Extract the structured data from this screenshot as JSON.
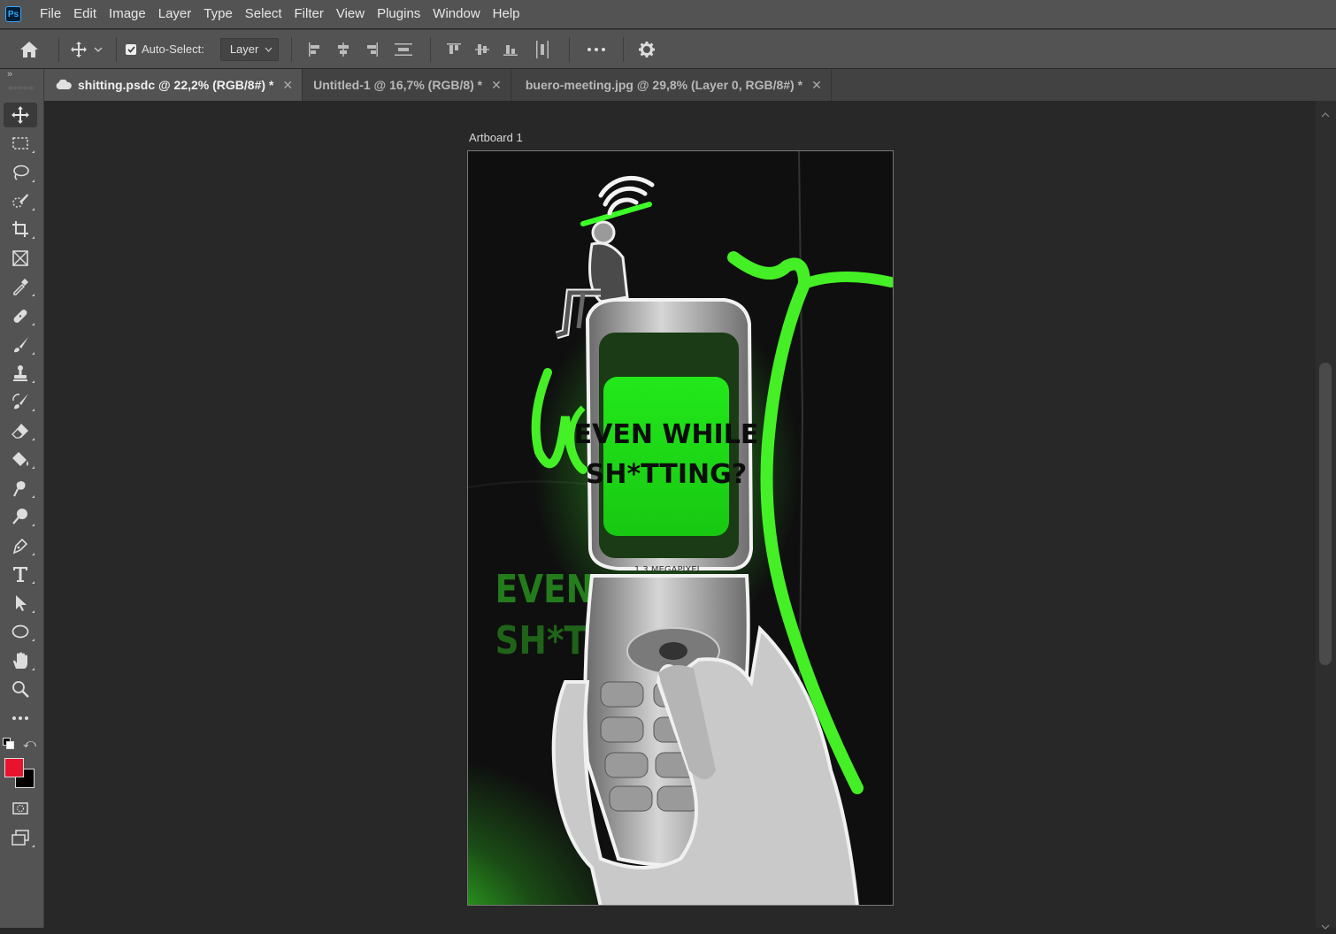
{
  "app": {
    "logo_text": "Ps"
  },
  "menu": [
    "File",
    "Edit",
    "Image",
    "Layer",
    "Type",
    "Select",
    "Filter",
    "View",
    "Plugins",
    "Window",
    "Help"
  ],
  "options": {
    "auto_select_label": "Auto-Select:",
    "auto_select_checked": true,
    "target_value": "Layer"
  },
  "tabs": [
    {
      "label": "shitting.psdc @ 22,2% (RGB/8#) *",
      "cloud": true,
      "active": true
    },
    {
      "label": "Untitled-1 @ 16,7% (RGB/8) *",
      "cloud": false,
      "active": false
    },
    {
      "label": "buero-meeting.jpg @ 29,8% (Layer 0, RGB/8#) *",
      "cloud": false,
      "active": false
    }
  ],
  "artboard": {
    "label": "Artboard 1",
    "screen_text_line1": "EVEN WHILE",
    "screen_text_line2": "SH*TTING?",
    "brand_text": "1.3 MEGAPIXEL",
    "ghost_line1": "EVEN",
    "ghost_line2": "SH*TT"
  },
  "tools": [
    "move",
    "marquee",
    "lasso",
    "quick-select",
    "crop",
    "frame",
    "eyedropper",
    "healing",
    "brush",
    "stamp",
    "history-brush",
    "eraser",
    "paint-bucket",
    "smudge",
    "dodge",
    "pen",
    "type",
    "path-select",
    "ellipse",
    "hand",
    "zoom",
    "more"
  ],
  "colors": {
    "foreground": "#e8132d",
    "background": "#000000",
    "accent_green": "#3dff2a"
  }
}
